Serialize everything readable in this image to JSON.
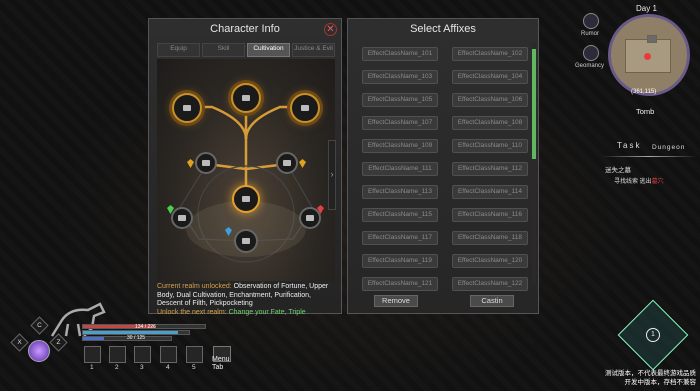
{
  "character_panel": {
    "title": "Character Info",
    "close_icon": "close-icon",
    "tabs": [
      "Equip",
      "Skill",
      "Cultivation",
      "Justice & Evil"
    ],
    "active_tab": "Cultivation",
    "realm_label": "Current realm unlocked:",
    "realm_value": "Observation of Fortune, Upper Body, Dual Cultivation, Enchantment, Purification, Descent of Filth, Pickpocketing",
    "next_label": "Unlock the next realm:",
    "next_value": "Change your Fate, Triple"
  },
  "affix_panel": {
    "title": "Select Affixes",
    "left_items": [
      "EffectClassName_101",
      "EffectClassName_103",
      "EffectClassName_105",
      "EffectClassName_107",
      "EffectClassName_109",
      "EffectClassName_111",
      "EffectClassName_113",
      "EffectClassName_115",
      "EffectClassName_117",
      "EffectClassName_119",
      "EffectClassName_121"
    ],
    "right_items": [
      "EffectClassName_102",
      "EffectClassName_104",
      "EffectClassName_106",
      "EffectClassName_108",
      "EffectClassName_110",
      "EffectClassName_112",
      "EffectClassName_114",
      "EffectClassName_116",
      "EffectClassName_118",
      "EffectClassName_120",
      "EffectClassName_122"
    ],
    "remove_label": "Remove",
    "cast_label": "Castin"
  },
  "minimap": {
    "day": "Day 1",
    "coords": "(361,115)",
    "location": "Tomb",
    "rumor": "Rumor",
    "geomancy": "Geomancy"
  },
  "task": {
    "title": "Task",
    "subtitle": "Dungeon",
    "line1": "迷失之墓",
    "line2_a": "寻找线索 逃出",
    "line2_b": "墓穴"
  },
  "hud": {
    "keys": [
      "C",
      "X",
      "Z"
    ],
    "hp_text": "134 / 226",
    "mp_text": "30 / 125",
    "hp_fraction": 0.59,
    "mp_fraction": 0.24,
    "hotbar_numbers": [
      "1",
      "2",
      "3",
      "4",
      "5"
    ],
    "menu_label": "Menu",
    "tab_label": "Tab"
  },
  "disclaimer": {
    "line1": "测试版本，不代表最终游戏品质",
    "line2": "开发中版本，存档不兼容"
  },
  "colors": {
    "accent_gold": "#c8902a",
    "next_green": "#6fd06f",
    "scroll_green": "#5fb85f",
    "hp_red": "#c04848",
    "mp_blue": "#4aa0c8"
  }
}
